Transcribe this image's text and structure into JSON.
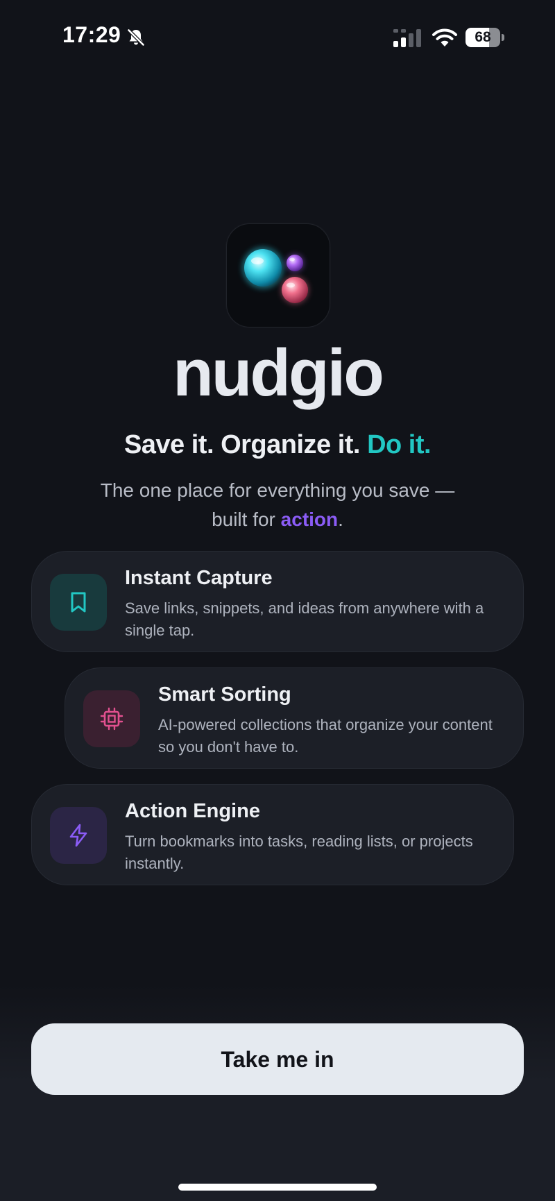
{
  "status_bar": {
    "time": "17:29",
    "battery_level": "68",
    "battery_fraction": 0.68,
    "icons": [
      "bell-slash-icon",
      "cellular-signal-icon",
      "wifi-icon",
      "battery-icon"
    ]
  },
  "logo": {
    "icon": "bubbles-logo",
    "colors": {
      "cyan": "#3fd6e8",
      "purple": "#a35cf0",
      "pink": "#f0708c"
    }
  },
  "app_name": "nudgio",
  "tagline": {
    "part1": "Save it. Organize it.",
    "accent": "Do it."
  },
  "subtitle": {
    "line1": "The one place for everything you save —",
    "line2_prefix": "built for",
    "accent": "action",
    "line2_suffix": "."
  },
  "features": [
    {
      "icon": "bookmark-icon",
      "title": "Instant Capture",
      "description": "Save links, snippets, and ideas from anywhere with a single tap."
    },
    {
      "icon": "cpu-chip-icon",
      "title": "Smart Sorting",
      "description": "AI-powered collections that organize your content so you don't have to."
    },
    {
      "icon": "lightning-bolt-icon",
      "title": "Action Engine",
      "description": "Turn bookmarks into tasks, reading lists, or projects instantly."
    }
  ],
  "cta": {
    "label": "Take me in"
  },
  "colors": {
    "background": "#111319",
    "card": "#1c1f27",
    "teal_accent": "#22c7c3",
    "purple_accent": "#8b5cf6",
    "pink_accent": "#e2508f",
    "button": "#e5eaf0"
  }
}
